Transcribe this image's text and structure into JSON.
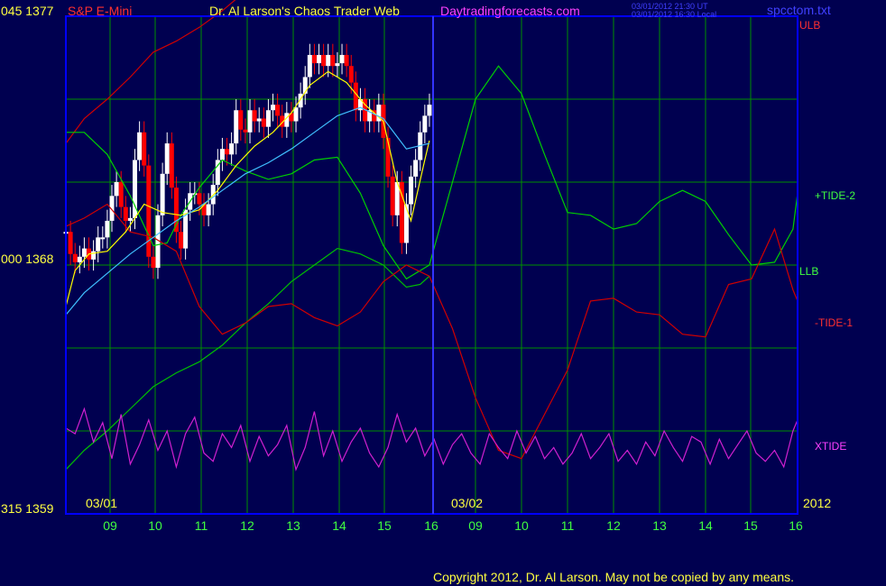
{
  "header": {
    "code_price_top": "045 1377",
    "instrument": "S&P E-Mini",
    "title": "Dr. Al Larson's Chaos Trader Web",
    "site": "Daytradingforecasts.com",
    "time_ut": "03/01/2012 21:30 UT",
    "time_local": "03/01/2012 16:30 Local",
    "filename": "spcctom.txt"
  },
  "axis": {
    "mid_label": "000 1368",
    "bottom_label": "315 1359",
    "date_left": "03/01",
    "date_right": "03/02",
    "year": "2012"
  },
  "legend": {
    "ulb": "ULB",
    "tide2": "+TIDE-2",
    "llb": "LLB",
    "tide1": "-TIDE-1",
    "xtide": "XTIDE"
  },
  "footer": {
    "copyright": "Copyright 2012, Dr. Al Larson. May not be copied by any means."
  },
  "colors": {
    "background": "#000050",
    "grid": "#009000",
    "plot_border": "#0000ff",
    "today_marker": "#3333ff",
    "ulb": "#d00000",
    "llb": "#00c000",
    "tide2": "#00d000",
    "tide1": "#d00000",
    "xtide": "#d020d0",
    "price_up": "#ffffff",
    "price_down": "#ff0000",
    "ma_fast": "#ffff00",
    "ma_slow": "#40c0ff",
    "title_red": "#ff3030",
    "title_yellow": "#ffff40",
    "title_magenta": "#ff40ff",
    "title_blue": "#4040ff",
    "label_green": "#40ff40"
  },
  "chart_data": {
    "type": "line",
    "ylim": [
      1359,
      1377
    ],
    "hour_ticks": [
      "09",
      "10",
      "11",
      "12",
      "13",
      "14",
      "15",
      "16",
      "09",
      "10",
      "11",
      "12",
      "13",
      "14",
      "15",
      "16"
    ],
    "days": [
      "03/01",
      "03/02"
    ],
    "x_hours_range": [
      8.1,
      24.0
    ],
    "series": [
      {
        "name": "ULB",
        "x": [
          8.1,
          8.5,
          9.0,
          9.5,
          10.0,
          10.5,
          11.0,
          11.5,
          12.0,
          12.5,
          13.0,
          13.5,
          14.0,
          14.5,
          15.0,
          15.5,
          16.0
        ],
        "values": [
          1372.4,
          1373.3,
          1374.0,
          1374.8,
          1375.7,
          1376.1,
          1376.6,
          1377.2,
          1377.9,
          1378.4,
          1378.8,
          1379.3,
          1379.8,
          1379.6,
          1378.9,
          1378.4,
          1378.6
        ]
      },
      {
        "name": "LLB",
        "x": [
          8.1,
          8.5,
          9.0,
          9.5,
          10.0,
          10.5,
          11.0,
          11.5,
          12.0,
          12.5,
          13.0,
          13.5,
          14.0,
          14.5,
          15.0,
          15.5,
          15.8,
          16.0
        ],
        "values": [
          1360.6,
          1361.3,
          1362.0,
          1362.8,
          1363.6,
          1364.1,
          1364.5,
          1365.1,
          1365.9,
          1366.6,
          1367.4,
          1368.0,
          1368.6,
          1368.4,
          1368.0,
          1367.2,
          1367.3,
          1367.6
        ]
      },
      {
        "name": "+TIDE-2",
        "x": [
          8.1,
          8.5,
          9.0,
          9.5,
          10.0,
          10.3,
          10.6,
          11.0,
          11.5,
          12.0,
          12.5,
          13.0,
          13.5,
          14.0,
          14.5,
          15.0,
          15.5,
          16.0,
          16.5,
          17.0,
          17.5,
          18.0,
          18.5,
          19.0,
          19.5,
          20.0,
          20.5,
          21.0,
          21.5,
          22.0,
          22.5,
          23.0,
          23.5,
          23.9,
          24.0
        ],
        "values": [
          1372.8,
          1372.8,
          1372.0,
          1370.5,
          1368.7,
          1368.8,
          1369.8,
          1370.8,
          1371.8,
          1371.4,
          1371.1,
          1371.3,
          1371.8,
          1371.9,
          1370.6,
          1368.7,
          1367.5,
          1368.0,
          1371.0,
          1374.0,
          1375.2,
          1374.2,
          1372.0,
          1369.9,
          1369.8,
          1369.3,
          1369.5,
          1370.3,
          1370.7,
          1370.3,
          1369.1,
          1368.0,
          1368.1,
          1369.3,
          1370.6
        ]
      },
      {
        "name": "-TIDE-1",
        "x": [
          8.1,
          8.5,
          9.0,
          9.5,
          10.0,
          10.5,
          11.0,
          11.5,
          12.0,
          12.5,
          13.0,
          13.5,
          14.0,
          14.5,
          15.0,
          15.5,
          16.0,
          16.5,
          17.0,
          17.5,
          18.0,
          18.5,
          19.0,
          19.5,
          20.0,
          20.5,
          21.0,
          21.5,
          22.0,
          22.5,
          23.0,
          23.5,
          23.9,
          24.0
        ],
        "values": [
          1369.4,
          1369.7,
          1370.2,
          1369.2,
          1369.0,
          1368.5,
          1366.5,
          1365.5,
          1365.9,
          1366.5,
          1366.6,
          1366.1,
          1365.8,
          1366.3,
          1367.4,
          1368.0,
          1367.6,
          1365.7,
          1363.2,
          1361.3,
          1361.0,
          1362.6,
          1364.2,
          1366.7,
          1366.8,
          1366.3,
          1366.2,
          1365.5,
          1365.4,
          1367.3,
          1367.5,
          1369.3,
          1367.1,
          1366.7
        ]
      },
      {
        "name": "XTIDE",
        "x": [
          8.1,
          8.3,
          8.5,
          8.7,
          8.9,
          9.1,
          9.3,
          9.5,
          9.7,
          9.9,
          10.1,
          10.3,
          10.5,
          10.7,
          10.9,
          11.1,
          11.3,
          11.5,
          11.7,
          11.9,
          12.1,
          12.3,
          12.5,
          12.7,
          12.9,
          13.1,
          13.3,
          13.5,
          13.7,
          13.9,
          14.1,
          14.3,
          14.5,
          14.7,
          14.9,
          15.1,
          15.3,
          15.5,
          15.7,
          15.9,
          16.1,
          16.3,
          16.5,
          16.7,
          16.9,
          17.1,
          17.3,
          17.5,
          17.7,
          17.9,
          18.1,
          18.3,
          18.5,
          18.7,
          18.9,
          19.1,
          19.3,
          19.5,
          19.7,
          19.9,
          20.1,
          20.3,
          20.5,
          20.7,
          20.9,
          21.1,
          21.3,
          21.5,
          21.7,
          21.9,
          22.1,
          22.3,
          22.5,
          22.7,
          22.9,
          23.1,
          23.3,
          23.5,
          23.7,
          23.9,
          24.0
        ],
        "values": [
          1362.1,
          1361.9,
          1362.8,
          1361.6,
          1362.3,
          1361.0,
          1362.6,
          1360.8,
          1361.5,
          1362.4,
          1361.3,
          1362.0,
          1360.7,
          1361.9,
          1362.5,
          1361.2,
          1360.9,
          1361.9,
          1361.4,
          1362.2,
          1360.9,
          1361.8,
          1361.1,
          1361.5,
          1362.2,
          1360.6,
          1361.4,
          1362.7,
          1361.1,
          1362.0,
          1360.9,
          1361.6,
          1362.1,
          1361.2,
          1360.7,
          1361.4,
          1362.6,
          1361.6,
          1362.1,
          1361.1,
          1361.7,
          1360.8,
          1361.5,
          1361.9,
          1361.2,
          1360.8,
          1361.9,
          1361.4,
          1361.0,
          1362.0,
          1361.2,
          1361.8,
          1361.0,
          1361.4,
          1360.8,
          1361.2,
          1361.9,
          1361.0,
          1361.4,
          1361.9,
          1360.9,
          1361.3,
          1360.8,
          1361.6,
          1361.1,
          1362.0,
          1361.4,
          1360.9,
          1361.8,
          1361.6,
          1360.8,
          1361.7,
          1361.0,
          1361.5,
          1362.0,
          1361.2,
          1360.9,
          1361.3,
          1360.7,
          1362.0,
          1362.4
        ]
      },
      {
        "name": "MA fast",
        "x": [
          8.1,
          8.3,
          8.6,
          9.0,
          9.4,
          9.8,
          10.2,
          10.6,
          11.0,
          11.4,
          11.8,
          12.2,
          12.6,
          13.0,
          13.4,
          13.8,
          14.2,
          14.6,
          15.0,
          15.3,
          15.6,
          15.9,
          16.0
        ],
        "values": [
          1366.5,
          1367.8,
          1368.4,
          1368.5,
          1369.2,
          1370.2,
          1369.9,
          1369.8,
          1370.0,
          1370.7,
          1371.6,
          1372.3,
          1372.8,
          1373.5,
          1374.5,
          1375.0,
          1374.6,
          1373.8,
          1373.2,
          1371.0,
          1369.6,
          1371.8,
          1372.5
        ]
      },
      {
        "name": "MA slow",
        "x": [
          8.1,
          8.5,
          9.0,
          9.5,
          10.0,
          10.5,
          11.0,
          11.5,
          12.0,
          12.5,
          13.0,
          13.5,
          14.0,
          14.5,
          15.0,
          15.5,
          16.0
        ],
        "values": [
          1366.2,
          1367.0,
          1367.7,
          1368.4,
          1369.0,
          1369.6,
          1370.1,
          1370.7,
          1371.3,
          1371.7,
          1372.2,
          1372.8,
          1373.4,
          1373.7,
          1373.3,
          1372.2,
          1372.4
        ]
      },
      {
        "name": "Price close",
        "x": [
          8.1,
          8.2,
          8.3,
          8.4,
          8.5,
          8.6,
          8.7,
          8.8,
          8.9,
          9.0,
          9.1,
          9.2,
          9.3,
          9.4,
          9.5,
          9.6,
          9.7,
          9.8,
          9.9,
          10.0,
          10.1,
          10.2,
          10.3,
          10.4,
          10.5,
          10.6,
          10.7,
          10.8,
          10.9,
          11.0,
          11.1,
          11.2,
          11.3,
          11.4,
          11.5,
          11.6,
          11.7,
          11.8,
          11.9,
          12.0,
          12.1,
          12.2,
          12.3,
          12.4,
          12.5,
          12.6,
          12.7,
          12.8,
          12.9,
          13.0,
          13.1,
          13.2,
          13.3,
          13.4,
          13.5,
          13.6,
          13.7,
          13.8,
          13.9,
          14.0,
          14.1,
          14.2,
          14.3,
          14.4,
          14.5,
          14.6,
          14.7,
          14.8,
          14.9,
          15.0,
          15.1,
          15.2,
          15.3,
          15.4,
          15.5,
          15.6,
          15.7,
          15.8,
          15.9,
          16.0
        ],
        "values": [
          1369.2,
          1368.4,
          1368.1,
          1368.3,
          1368.6,
          1368.2,
          1368.5,
          1369.0,
          1369.0,
          1369.6,
          1370.5,
          1371.0,
          1370.1,
          1369.6,
          1369.7,
          1371.8,
          1372.8,
          1371.6,
          1368.3,
          1367.9,
          1369.8,
          1371.3,
          1372.4,
          1370.8,
          1369.2,
          1368.6,
          1370.0,
          1370.6,
          1370.6,
          1370.2,
          1369.8,
          1370.2,
          1370.9,
          1371.8,
          1372.2,
          1372.0,
          1372.4,
          1373.6,
          1372.9,
          1372.8,
          1373.6,
          1373.2,
          1373.3,
          1373.0,
          1373.6,
          1373.8,
          1373.4,
          1373.0,
          1373.5,
          1373.2,
          1373.7,
          1374.2,
          1374.8,
          1375.6,
          1375.3,
          1375.6,
          1375.2,
          1375.6,
          1375.2,
          1375.3,
          1375.6,
          1375.2,
          1374.6,
          1373.6,
          1374.0,
          1373.2,
          1373.6,
          1373.2,
          1373.8,
          1372.6,
          1371.2,
          1369.8,
          1371.0,
          1368.8,
          1370.2,
          1371.2,
          1371.8,
          1372.8,
          1373.4,
          1373.8
        ]
      }
    ],
    "price_bars_note": "white = up bars, red = down bars"
  }
}
